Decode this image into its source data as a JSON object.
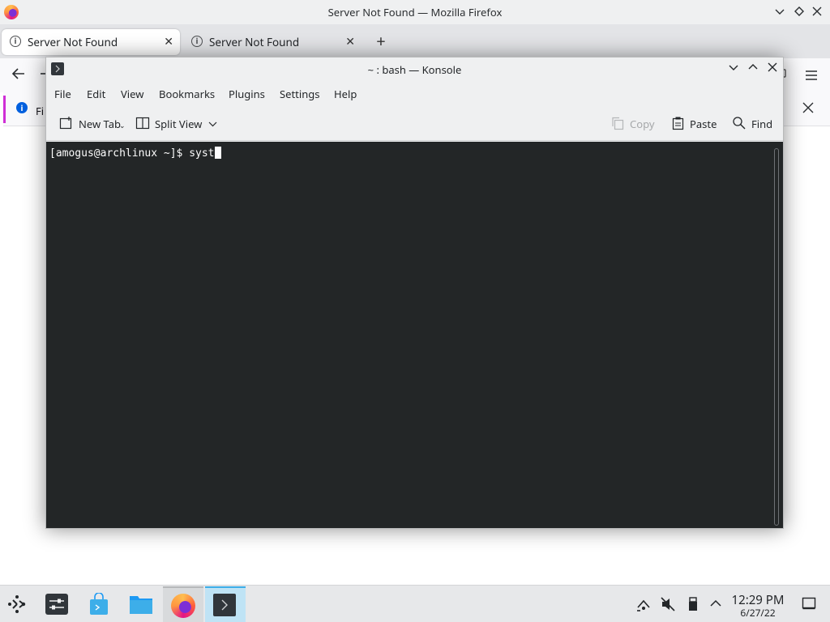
{
  "firefox": {
    "window_title": "Server Not Found — Mozilla Firefox",
    "tabs": [
      {
        "label": "Server Not Found",
        "active": true
      },
      {
        "label": "Server Not Found",
        "active": false
      }
    ],
    "new_tab_glyph": "+",
    "notice_text": "Fi",
    "colors": {
      "notice_accent": "#cf2fd6",
      "info_blue": "#0060df"
    }
  },
  "konsole": {
    "window_title": "~ : bash — Konsole",
    "menus": [
      "File",
      "Edit",
      "View",
      "Bookmarks",
      "Plugins",
      "Settings",
      "Help"
    ],
    "toolbar": {
      "new_tab": "New Tab",
      "split_view": "Split View",
      "copy": "Copy",
      "paste": "Paste",
      "find": "Find"
    },
    "terminal": {
      "prompt": "[amogus@archlinux ~]$ ",
      "input": "syst"
    },
    "colors": {
      "terminal_bg": "#232627",
      "terminal_fg": "#fcfcfc"
    }
  },
  "taskbar": {
    "clock_time": "12:29 PM",
    "clock_date": "6/27/22",
    "colors": {
      "active_bg": "#bfe3f5",
      "active_accent": "#3daee9"
    }
  }
}
